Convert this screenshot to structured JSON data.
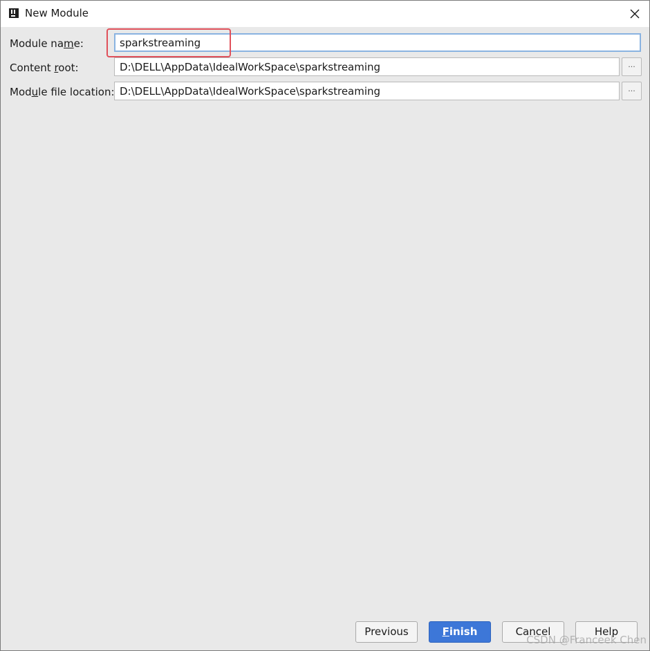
{
  "window": {
    "title": "New Module",
    "app_icon": "intellij-idea-icon",
    "close_icon": "close-icon"
  },
  "form": {
    "module_name": {
      "label_pre": "Module na",
      "label_mn": "m",
      "label_post": "e:",
      "value": "sparkstreaming"
    },
    "content_root": {
      "label_pre": "Content ",
      "label_mn": "r",
      "label_post": "oot:",
      "value": "D:\\DELL\\AppData\\IdealWorkSpace\\sparkstreaming",
      "browse_label": "..."
    },
    "module_file_location": {
      "label_pre": "Mod",
      "label_mn": "u",
      "label_post": "le file location:",
      "value": "D:\\DELL\\AppData\\IdealWorkSpace\\sparkstreaming",
      "browse_label": "..."
    }
  },
  "footer": {
    "previous_label": "Previous",
    "finish_mn": "F",
    "finish_rest": "inish",
    "cancel_label": "Cancel",
    "help_label": "Help"
  },
  "watermark": "CSDN @Franceek Chen",
  "colors": {
    "primary_button": "#3d77d8",
    "focus_border": "#89b3e1",
    "highlight_box": "#e0505a",
    "dialog_background": "#e9e9e9"
  }
}
